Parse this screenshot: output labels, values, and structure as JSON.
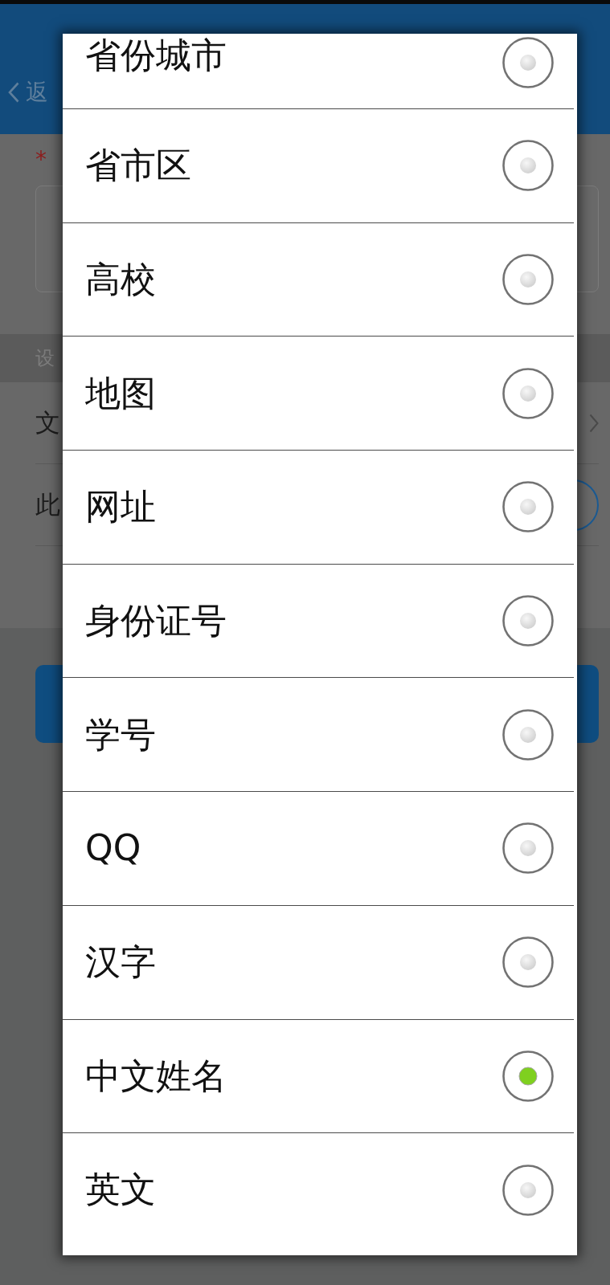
{
  "header": {
    "back_label": "返"
  },
  "form": {
    "required_mark": "*",
    "section_title": "设",
    "rows": [
      {
        "kind": "link",
        "label": "文"
      },
      {
        "kind": "switch",
        "label": "此"
      }
    ]
  },
  "dialog": {
    "options": [
      {
        "label": "省份城市",
        "selected": false
      },
      {
        "label": "省市区",
        "selected": false
      },
      {
        "label": "高校",
        "selected": false
      },
      {
        "label": "地图",
        "selected": false
      },
      {
        "label": "网址",
        "selected": false
      },
      {
        "label": "身份证号",
        "selected": false
      },
      {
        "label": "学号",
        "selected": false
      },
      {
        "label": "QQ",
        "selected": false
      },
      {
        "label": "汉字",
        "selected": false
      },
      {
        "label": "中文姓名",
        "selected": true
      },
      {
        "label": "英文",
        "selected": false
      }
    ]
  }
}
